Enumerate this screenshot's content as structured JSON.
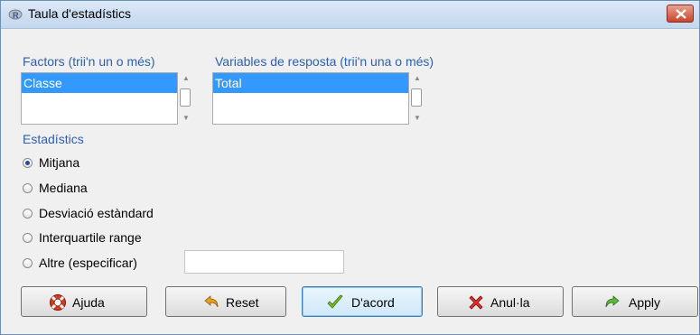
{
  "window": {
    "title": "Taula d'estadístics",
    "close_label": "×"
  },
  "factors": {
    "label": "Factors (trii'n un o més)",
    "items": [
      "Classe"
    ]
  },
  "responses": {
    "label": "Variables de resposta (trii'n una o més)",
    "items": [
      "Total"
    ]
  },
  "statistics": {
    "label": "Estadístics",
    "options": [
      {
        "label": "Mitjana",
        "checked": true
      },
      {
        "label": "Mediana",
        "checked": false
      },
      {
        "label": "Desviació estàndard",
        "checked": false
      },
      {
        "label": "Interquartile range",
        "checked": false
      },
      {
        "label": "Altre (especificar)",
        "checked": false
      }
    ],
    "other_value": ""
  },
  "buttons": {
    "help": "Ajuda",
    "reset": "Reset",
    "ok": "D'acord",
    "cancel": "Anul·la",
    "apply": "Apply"
  },
  "colors": {
    "accent": "#3399ff",
    "label_blue": "#2d5fb0"
  }
}
